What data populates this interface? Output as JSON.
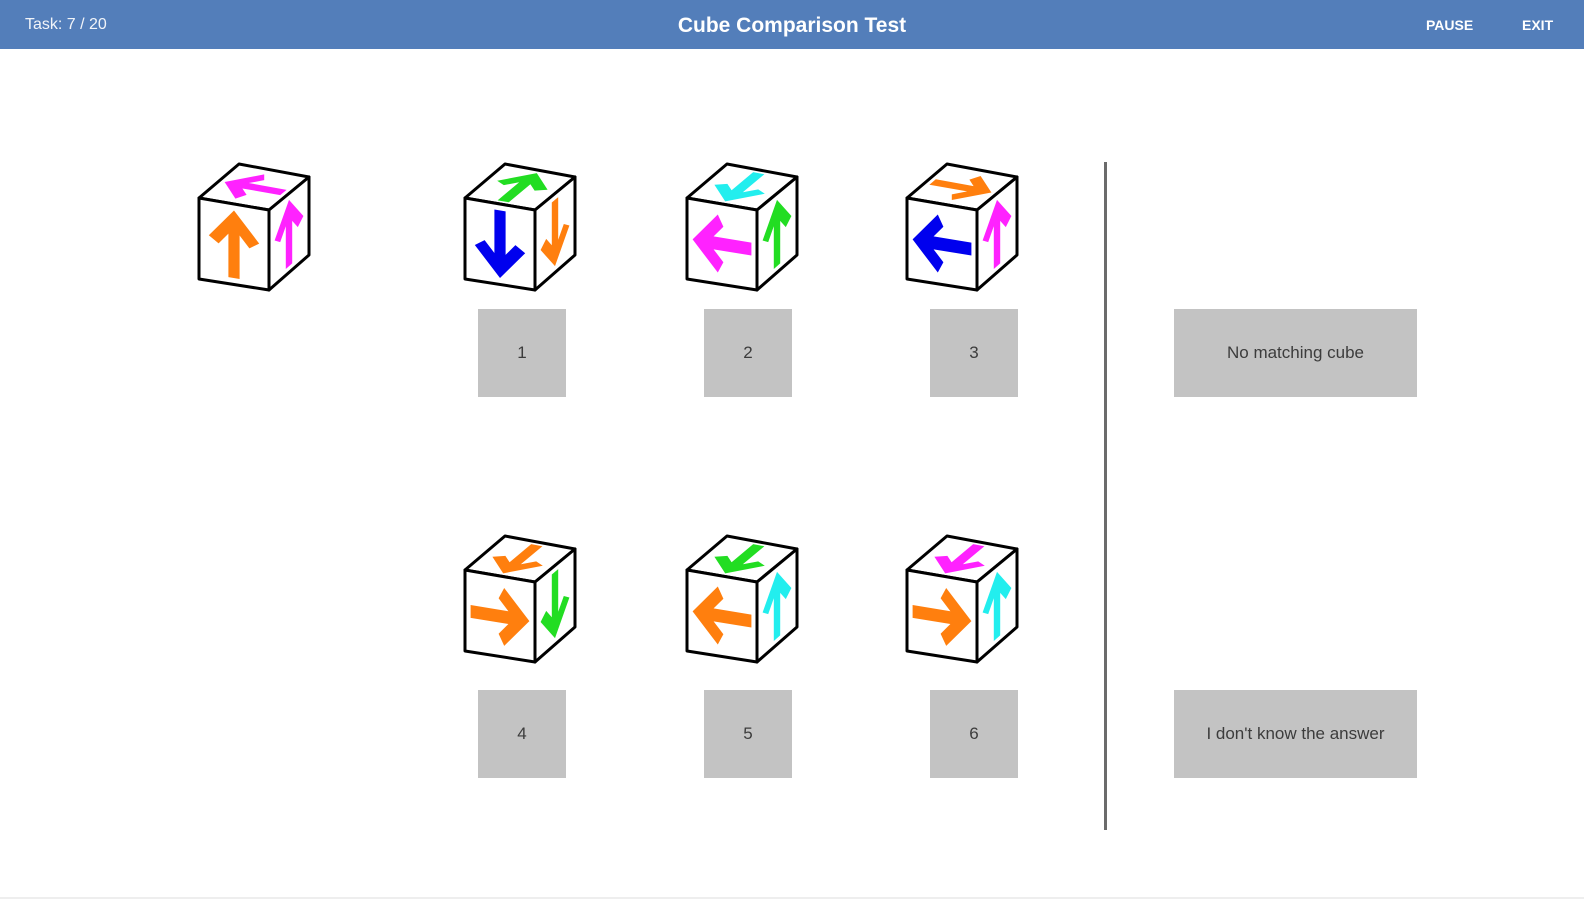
{
  "header": {
    "task_label": "Task: 7 / 20",
    "title": "Cube Comparison Test",
    "pause_label": "PAUSE",
    "exit_label": "EXIT"
  },
  "colors": {
    "header_bg": "#537eba",
    "button_bg": "#c3c3c3",
    "orange": "#ff7f0e",
    "magenta": "#ff22ff",
    "green": "#22dd22",
    "blue": "#0000ee",
    "cyan": "#22eeee"
  },
  "reference_cube": {
    "top": {
      "color": "magenta",
      "dir": "left"
    },
    "front": {
      "color": "orange",
      "dir": "up"
    },
    "side": {
      "color": "magenta",
      "dir": "up"
    }
  },
  "options": [
    {
      "label": "1",
      "cube": {
        "top": {
          "color": "green",
          "dir": "up"
        },
        "front": {
          "color": "blue",
          "dir": "down"
        },
        "side": {
          "color": "orange",
          "dir": "down"
        }
      }
    },
    {
      "label": "2",
      "cube": {
        "top": {
          "color": "cyan",
          "dir": "down"
        },
        "front": {
          "color": "magenta",
          "dir": "left"
        },
        "side": {
          "color": "green",
          "dir": "up"
        }
      }
    },
    {
      "label": "3",
      "cube": {
        "top": {
          "color": "orange",
          "dir": "right"
        },
        "front": {
          "color": "blue",
          "dir": "left"
        },
        "side": {
          "color": "magenta",
          "dir": "up"
        }
      }
    },
    {
      "label": "4",
      "cube": {
        "top": {
          "color": "orange",
          "dir": "down"
        },
        "front": {
          "color": "orange",
          "dir": "right"
        },
        "side": {
          "color": "green",
          "dir": "down"
        }
      }
    },
    {
      "label": "5",
      "cube": {
        "top": {
          "color": "green",
          "dir": "down"
        },
        "front": {
          "color": "orange",
          "dir": "left"
        },
        "side": {
          "color": "cyan",
          "dir": "up"
        }
      }
    },
    {
      "label": "6",
      "cube": {
        "top": {
          "color": "magenta",
          "dir": "down"
        },
        "front": {
          "color": "orange",
          "dir": "right"
        },
        "side": {
          "color": "cyan",
          "dir": "up"
        }
      }
    }
  ],
  "no_match_label": "No matching cube",
  "dont_know_label": "I don't know the answer"
}
